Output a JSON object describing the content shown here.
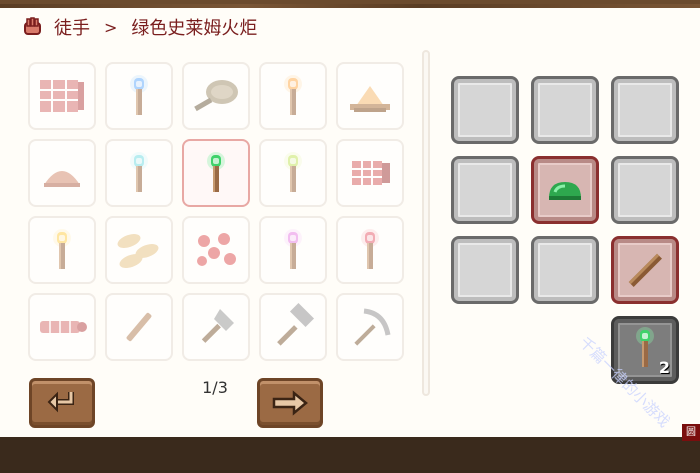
{
  "header": {
    "category": "徒手",
    "separator": ">",
    "item_name": "绿色史莱姆火炬"
  },
  "recipes": [
    {
      "icon": "banner-icon",
      "selected": false
    },
    {
      "icon": "blue-torch-icon",
      "selected": false
    },
    {
      "icon": "frying-pan-icon",
      "selected": false
    },
    {
      "icon": "orange-torch-icon",
      "selected": false
    },
    {
      "icon": "campfire-icon",
      "selected": false
    },
    {
      "icon": "dirt-pile-icon",
      "selected": false
    },
    {
      "icon": "cyan-torch-icon",
      "selected": false
    },
    {
      "icon": "green-slime-torch-icon",
      "selected": true
    },
    {
      "icon": "yellow-green-torch-icon",
      "selected": false
    },
    {
      "icon": "banner-roll-icon",
      "selected": false
    },
    {
      "icon": "yellow-torch-icon",
      "selected": false
    },
    {
      "icon": "bread-loaves-icon",
      "selected": false
    },
    {
      "icon": "red-berries-icon",
      "selected": false
    },
    {
      "icon": "pink-torch-icon",
      "selected": false
    },
    {
      "icon": "red-torch-icon",
      "selected": false
    },
    {
      "icon": "rolled-rug-icon",
      "selected": false
    },
    {
      "icon": "stick-icon",
      "selected": false
    },
    {
      "icon": "shovel-icon",
      "selected": false
    },
    {
      "icon": "hammer-icon",
      "selected": false
    },
    {
      "icon": "pickaxe-icon",
      "selected": false
    }
  ],
  "pagination": {
    "current": "1/3",
    "prev_icon": "return-arrow-icon",
    "next_icon": "right-arrow-icon"
  },
  "crafting": {
    "slots": [
      {
        "item": null
      },
      {
        "item": null
      },
      {
        "item": null
      },
      {
        "item": null
      },
      {
        "item": "green-slime-gel-icon"
      },
      {
        "item": null
      },
      {
        "item": null
      },
      {
        "item": null
      },
      {
        "item": "wooden-stick-icon"
      }
    ],
    "result": {
      "item": "green-slime-torch-icon",
      "count": "2"
    }
  },
  "overlay": {
    "watermark": "千篇一律的小游戏",
    "corner_tag": "圆"
  },
  "colors": {
    "accent": "#7a1e1e",
    "panel_bg": "#fffdf8",
    "frame": "#6b4b2e",
    "slot_empty": "#d6d6d6",
    "slot_filled": "#d7b6b2",
    "nav_button": "#9b6a44"
  }
}
